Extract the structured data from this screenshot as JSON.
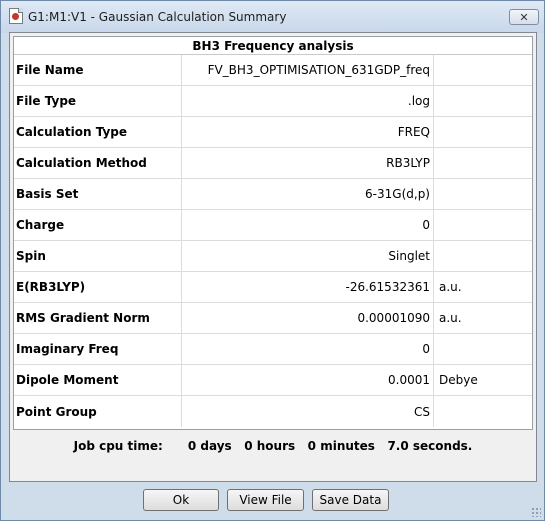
{
  "window": {
    "title": "G1:M1:V1 - Gaussian Calculation Summary",
    "close_glyph": "✕",
    "app_icon": "gaussview-document-icon"
  },
  "table": {
    "header": "BH3 Frequency analysis",
    "rows": [
      {
        "label": "File Name",
        "value": "FV_BH3_OPTIMISATION_631GDP_freq",
        "unit": ""
      },
      {
        "label": "File Type",
        "value": ".log",
        "unit": ""
      },
      {
        "label": "Calculation Type",
        "value": "FREQ",
        "unit": ""
      },
      {
        "label": "Calculation Method",
        "value": "RB3LYP",
        "unit": ""
      },
      {
        "label": "Basis Set",
        "value": "6-31G(d,p)",
        "unit": ""
      },
      {
        "label": "Charge",
        "value": "0",
        "unit": ""
      },
      {
        "label": "Spin",
        "value": "Singlet",
        "unit": ""
      },
      {
        "label": "E(RB3LYP)",
        "value": "-26.61532361",
        "unit": "a.u."
      },
      {
        "label": "RMS Gradient Norm",
        "value": "0.00001090",
        "unit": "a.u."
      },
      {
        "label": "Imaginary Freq",
        "value": "0",
        "unit": ""
      },
      {
        "label": "Dipole Moment",
        "value": "0.0001",
        "unit": "Debye"
      },
      {
        "label": "Point Group",
        "value": "CS",
        "unit": ""
      }
    ]
  },
  "cpu_time": "Job cpu time:      0 days   0 hours   0 minutes   7.0 seconds.",
  "buttons": {
    "ok": "Ok",
    "view_file": "View File",
    "save_data": "Save Data"
  },
  "colors": {
    "window_frame": "#cfdcea",
    "content_bg": "#f0f0f0",
    "table_bg": "#ffffff"
  }
}
